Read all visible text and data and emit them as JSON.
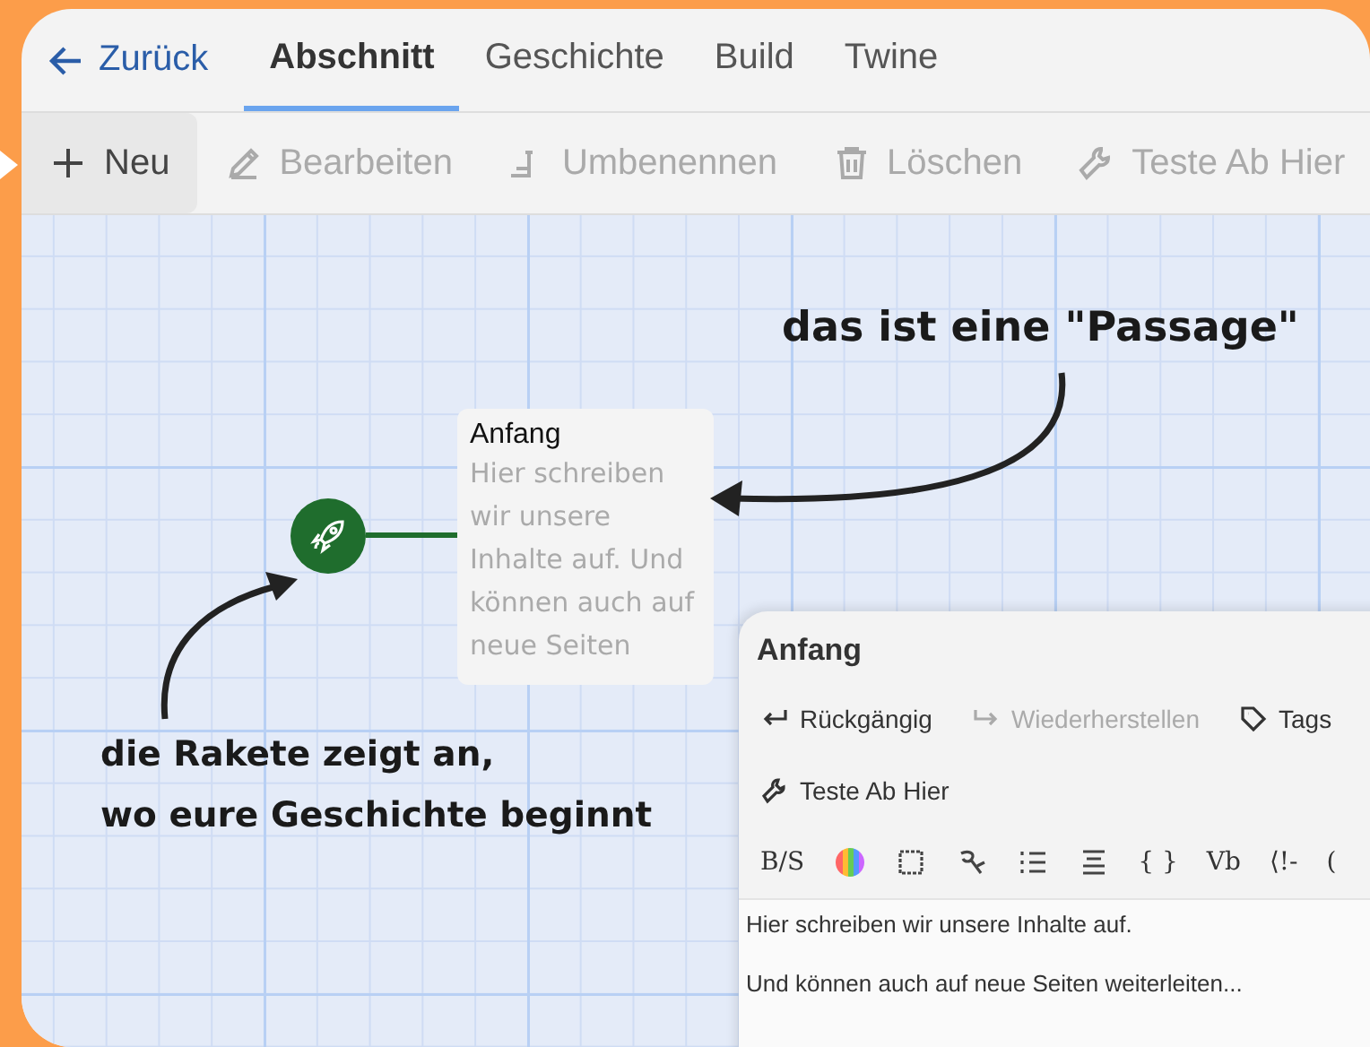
{
  "nav": {
    "back": "Zurück",
    "tabs": [
      {
        "label": "Abschnitt",
        "selected": true
      },
      {
        "label": "Geschichte",
        "selected": false
      },
      {
        "label": "Build",
        "selected": false
      },
      {
        "label": "Twine",
        "selected": false
      }
    ]
  },
  "toolbar": [
    {
      "label": "Neu",
      "disabled": false
    },
    {
      "label": "Bearbeiten",
      "disabled": true
    },
    {
      "label": "Umbenennen",
      "disabled": true
    },
    {
      "label": "Löschen",
      "disabled": true
    },
    {
      "label": "Teste Ab Hier",
      "disabled": true
    }
  ],
  "canvas": {
    "passage": {
      "title": "Anfang",
      "excerpt": "Hier schreiben wir unsere Inhalte auf. Und können auch auf neue Seiten"
    },
    "annotations": [
      {
        "kind": "passage",
        "text": "das ist eine \"Passage\""
      },
      {
        "kind": "start",
        "lines": [
          "die Rakete zeigt an,",
          "wo eure Geschichte beginnt"
        ]
      }
    ]
  },
  "editor": {
    "title": "Anfang",
    "actions": [
      {
        "label": "Rückgängig",
        "disabled": false
      },
      {
        "label": "Wiederherstellen",
        "disabled": true
      },
      {
        "label": "Tags",
        "disabled": false
      },
      {
        "label": "Teste Ab Hier",
        "disabled": false
      }
    ],
    "format": [
      {
        "kind": "text",
        "text": "B/S"
      },
      {
        "kind": "color"
      },
      {
        "kind": "box"
      },
      {
        "kind": "script"
      },
      {
        "kind": "list"
      },
      {
        "kind": "align"
      },
      {
        "kind": "text",
        "text": "{ }"
      },
      {
        "kind": "text",
        "text": "Vb"
      },
      {
        "kind": "text",
        "text": "⟨!-"
      },
      {
        "kind": "text",
        "text": "("
      }
    ],
    "paragraphs": [
      "Hier schreiben wir unsere Inhalte auf.",
      "Und können auch auf neue Seiten weiterleiten..."
    ]
  }
}
